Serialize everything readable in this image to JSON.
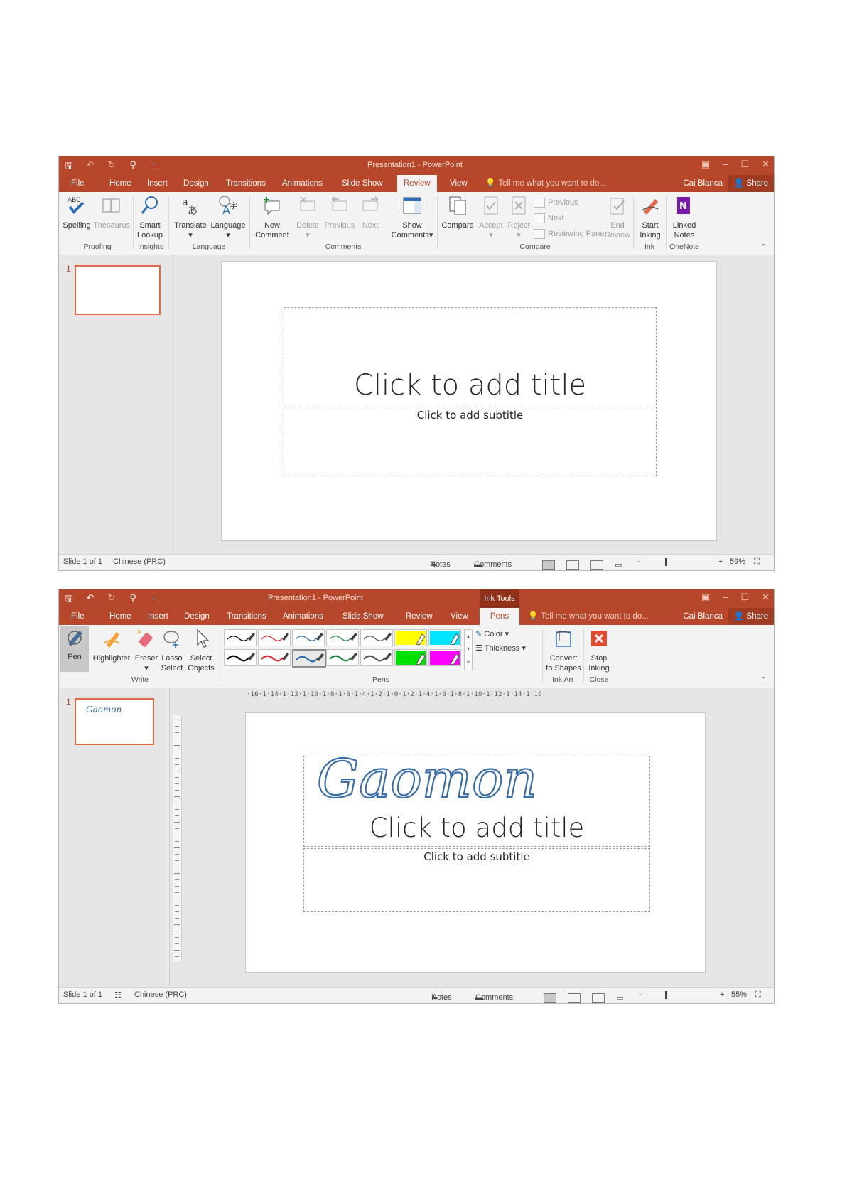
{
  "common": {
    "qat_save": "🖫",
    "qat_undo": "↶",
    "qat_redo": "↻",
    "qat_extra": "⚲",
    "qat_more": "=",
    "title": "Presentation1 - PowerPoint",
    "user": "Cai Blanca",
    "share": "Share",
    "tell_me": "Tell me what you want to do...",
    "title_placeholder": "Click to add title",
    "subtitle_placeholder": "Click to add subtitle",
    "slide_number": "1",
    "status_slide": "Slide 1 of 1",
    "status_language": "Chinese (PRC)",
    "status_notes": "Notes",
    "status_comments": "Comments",
    "brand_color": "#b7472a"
  },
  "window1": {
    "tabs": [
      "File",
      "Home",
      "Insert",
      "Design",
      "Transitions",
      "Animations",
      "Slide Show",
      "Review",
      "View"
    ],
    "active_tab": "Review",
    "ribbon": {
      "spelling": "Spelling",
      "thesaurus": "Thesaurus",
      "smart_lookup_1": "Smart",
      "smart_lookup_2": "Lookup",
      "translate": "Translate",
      "language": "Language",
      "new_comment_1": "New",
      "new_comment_2": "Comment",
      "delete": "Delete",
      "previous": "Previous",
      "next": "Next",
      "show_comments_1": "Show",
      "show_comments_2": "Comments",
      "compare": "Compare",
      "accept": "Accept",
      "reject": "Reject",
      "compare_previous": "Previous",
      "compare_next": "Next",
      "reviewing_pane": "Reviewing Pane",
      "end_review_1": "End",
      "end_review_2": "Review",
      "start_inking_1": "Start",
      "start_inking_2": "Inking",
      "linked_notes_1": "Linked",
      "linked_notes_2": "Notes",
      "abc_label": "ABC"
    },
    "groups": [
      "Proofing",
      "Insights",
      "Language",
      "Comments",
      "Compare",
      "Ink",
      "OneNote"
    ],
    "zoom": "59%",
    "zoom_level": 0.59
  },
  "window2": {
    "tabs": [
      "File",
      "Home",
      "Insert",
      "Design",
      "Transitions",
      "Animations",
      "Slide Show",
      "Review",
      "View",
      "Pens"
    ],
    "active_tab": "Pens",
    "ink_tools": "Ink Tools",
    "ribbon": {
      "pen": "Pen",
      "highlighter": "Highlighter",
      "eraser": "Eraser",
      "lasso_1": "Lasso",
      "lasso_2": "Select",
      "select_1": "Select",
      "select_2": "Objects",
      "color": "Color",
      "thickness": "Thickness",
      "convert_1": "Convert",
      "convert_2": "to Shapes",
      "stop_1": "Stop",
      "stop_2": "Inking"
    },
    "groups": [
      "Write",
      "Pens",
      "Ink Art",
      "Close"
    ],
    "pen_palette": [
      [
        "#000000",
        "#e0242a",
        "#2f6db5",
        "#1f8a3c",
        "#555555",
        "#ffff00",
        "#00e5ff"
      ],
      [
        "#000000",
        "#e0242a",
        "#2f6db5",
        "#1f8a3c",
        "#555555",
        "#00e000",
        "#ff00ff"
      ]
    ],
    "selected_pen": [
      1,
      2
    ],
    "ink_text": "Gaomon",
    "ink_color": "#3a6ea5",
    "ruler": "·16·1·14·1·12·1·10·1·8·1·6·1·4·1·2·1·0·1·2·1·4·1·6·1·8·1·10·1·12·1·14·1·16·",
    "zoom": "55%",
    "zoom_level": 0.55
  }
}
